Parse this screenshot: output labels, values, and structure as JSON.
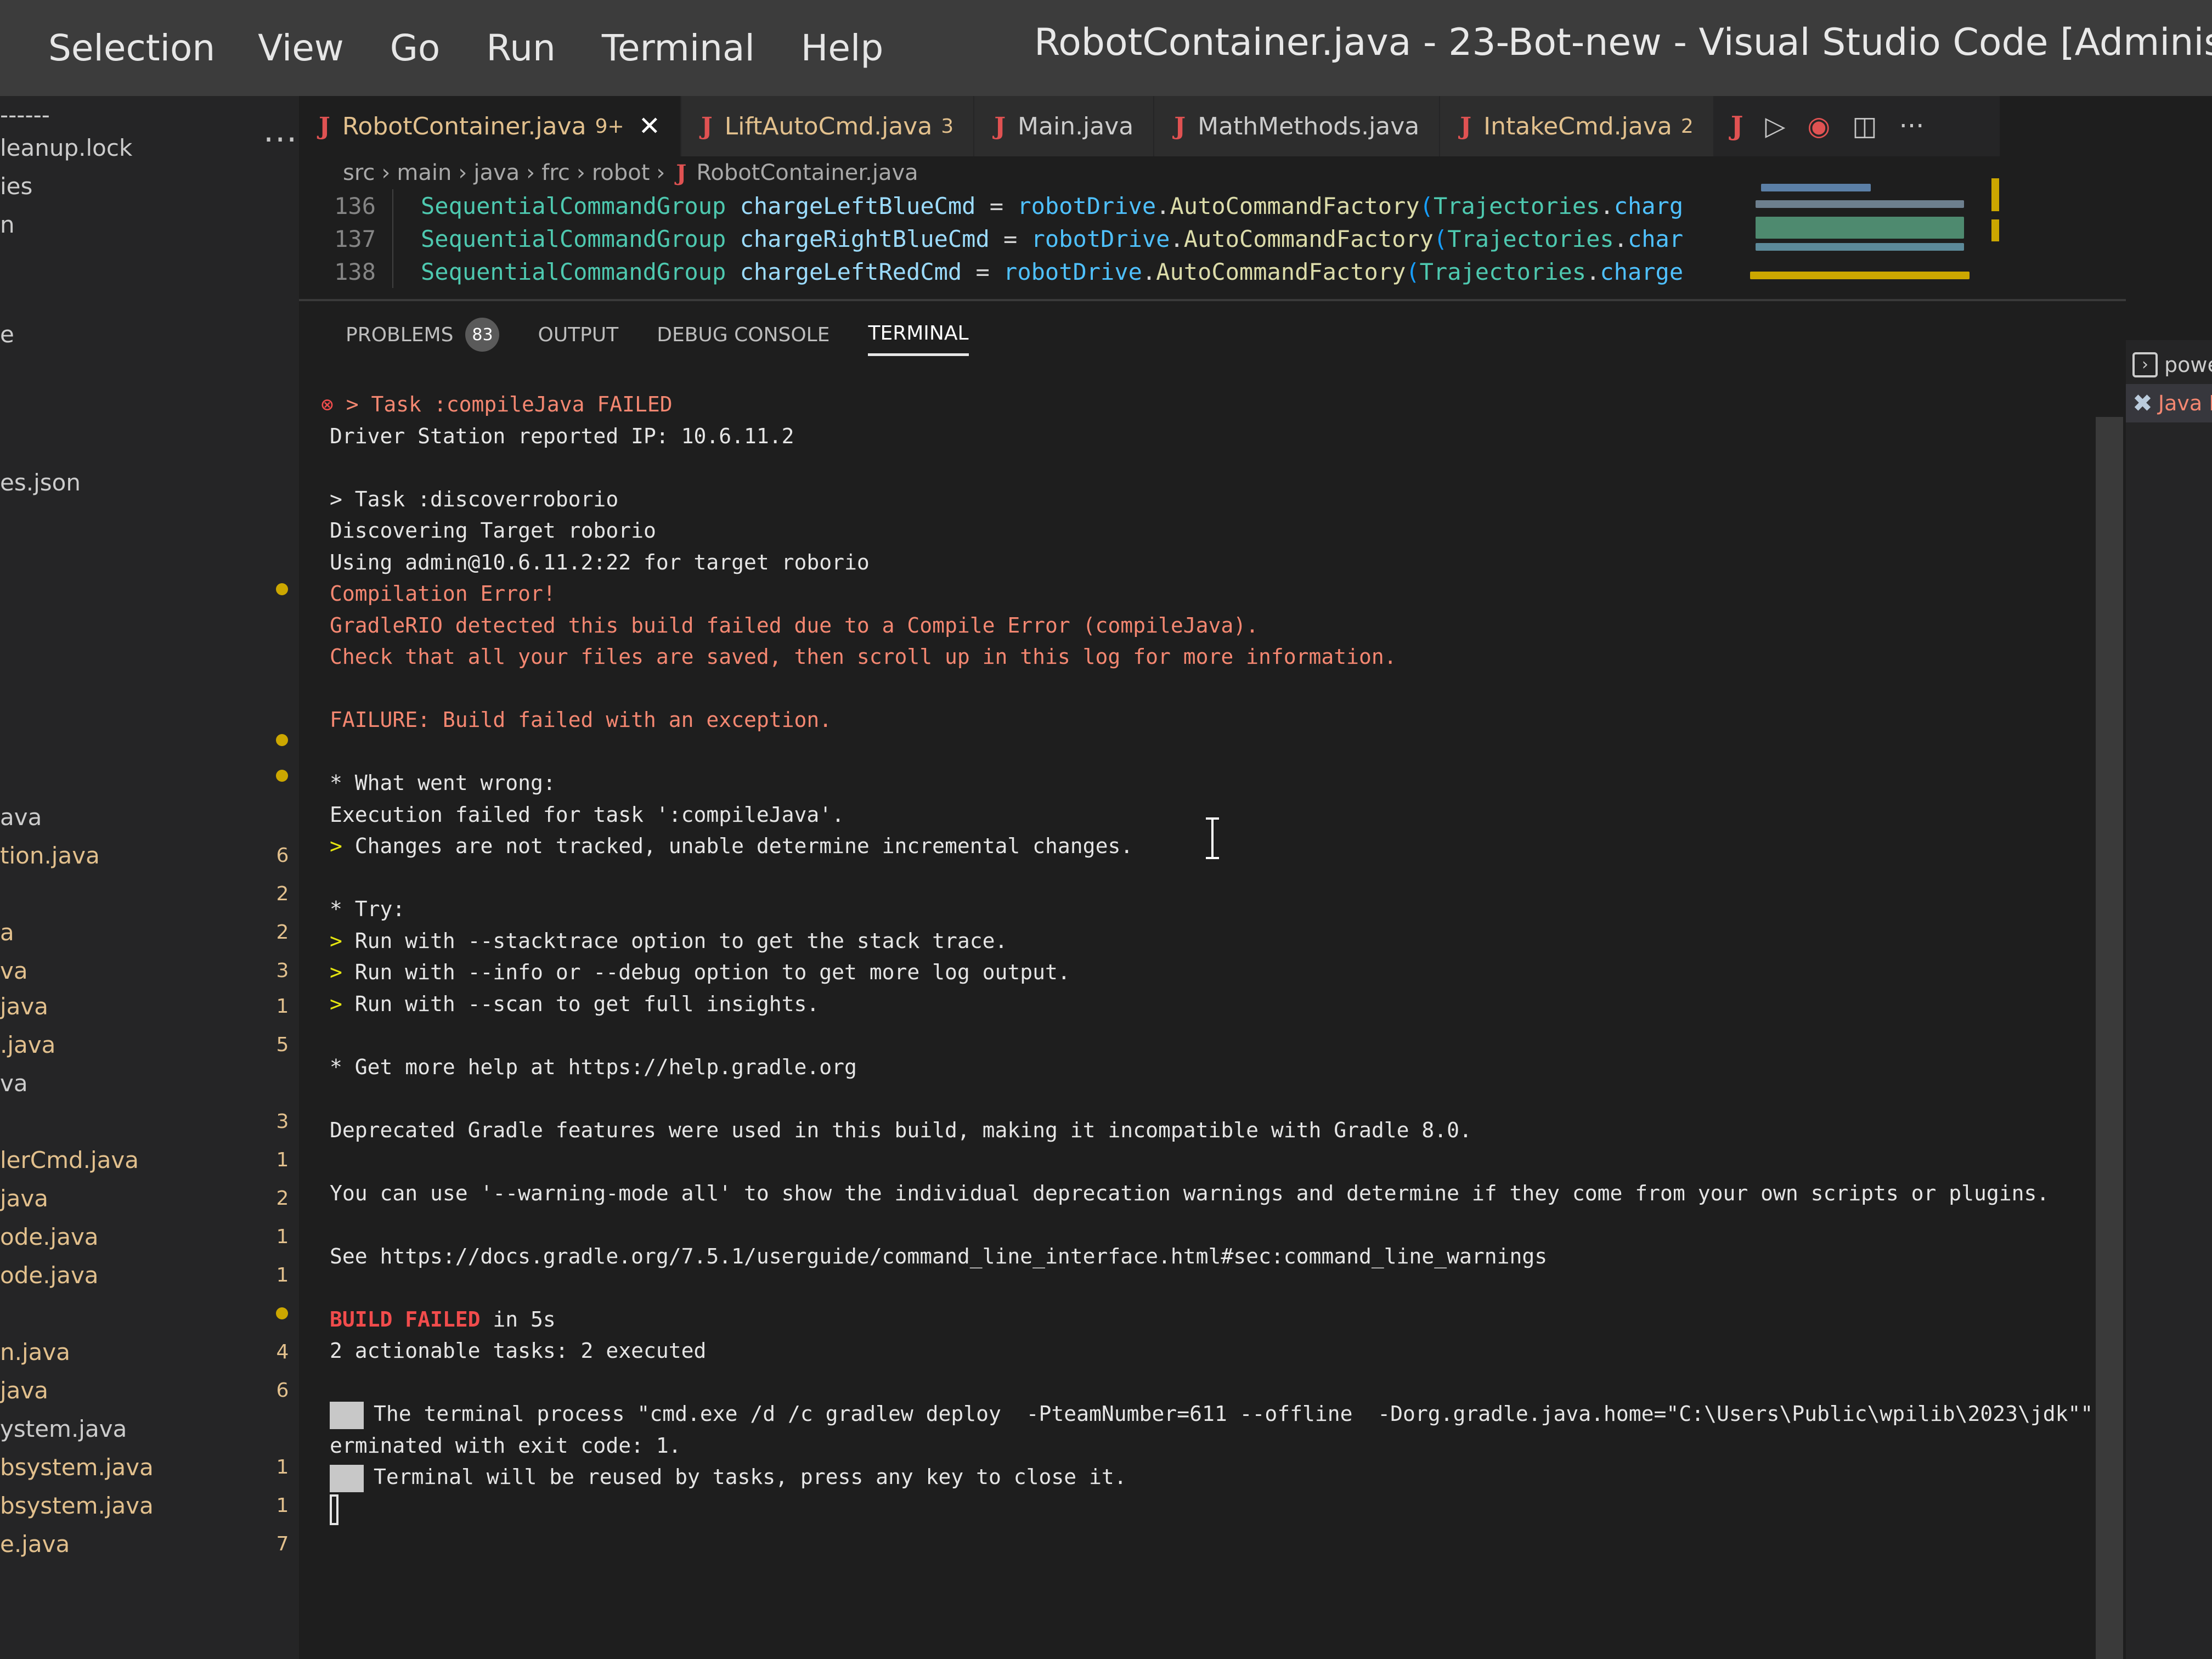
{
  "menu": {
    "items": [
      "Selection",
      "View",
      "Go",
      "Run",
      "Terminal",
      "Help"
    ]
  },
  "window_title": "RobotContainer.java - 23-Bot-new - Visual Studio Code [Administrator]",
  "sidebar": {
    "more_label": "...",
    "items": [
      {
        "label": "------",
        "badge": "",
        "status": "normal",
        "dot": false
      },
      {
        "label": "leanup.lock",
        "badge": "",
        "status": "normal",
        "dot": false
      },
      {
        "label": "ies",
        "badge": "",
        "status": "normal",
        "dot": false
      },
      {
        "label": "n",
        "badge": "",
        "status": "normal",
        "dot": false
      },
      {
        "label": "e",
        "badge": "",
        "status": "normal",
        "dot": false
      },
      {
        "label": "es.json",
        "badge": "",
        "status": "normal",
        "dot": false
      },
      {
        "label": "",
        "badge": "",
        "status": "warn",
        "dot": true
      },
      {
        "label": "",
        "badge": "",
        "status": "warn",
        "dot": true
      },
      {
        "label": "",
        "badge": "",
        "status": "warn",
        "dot": true
      },
      {
        "label": "ava",
        "badge": "",
        "status": "normal",
        "dot": false
      },
      {
        "label": "tion.java",
        "badge": "6",
        "status": "warn",
        "dot": false
      },
      {
        "label": "",
        "badge": "2",
        "status": "warn",
        "dot": false
      },
      {
        "label": "a",
        "badge": "2",
        "status": "warn",
        "dot": false
      },
      {
        "label": "va",
        "badge": "3",
        "status": "warn",
        "dot": false
      },
      {
        "label": "java",
        "badge": "1",
        "status": "warn",
        "dot": false
      },
      {
        "label": ".java",
        "badge": "5",
        "status": "warn",
        "dot": false
      },
      {
        "label": "va",
        "badge": "",
        "status": "normal",
        "dot": false
      },
      {
        "label": "",
        "badge": "3",
        "status": "warn",
        "dot": false
      },
      {
        "label": "lerCmd.java",
        "badge": "1",
        "status": "warn",
        "dot": false
      },
      {
        "label": "java",
        "badge": "2",
        "status": "warn",
        "dot": false
      },
      {
        "label": "ode.java",
        "badge": "1",
        "status": "warn",
        "dot": false
      },
      {
        "label": "ode.java",
        "badge": "1",
        "status": "warn",
        "dot": false
      },
      {
        "label": "",
        "badge": "",
        "status": "warn",
        "dot": true
      },
      {
        "label": "n.java",
        "badge": "4",
        "status": "warn",
        "dot": false
      },
      {
        "label": "java",
        "badge": "6",
        "status": "warn",
        "dot": false
      },
      {
        "label": "ystem.java",
        "badge": "",
        "status": "normal",
        "dot": false
      },
      {
        "label": "bsystem.java",
        "badge": "1",
        "status": "warn",
        "dot": false
      },
      {
        "label": "bsystem.java",
        "badge": "1",
        "status": "warn",
        "dot": false
      },
      {
        "label": "e.java",
        "badge": "7",
        "status": "warn",
        "dot": false
      }
    ]
  },
  "tabs": [
    {
      "label": "RobotContainer.java",
      "count": "9+",
      "active": true,
      "status": "warn",
      "closable": true
    },
    {
      "label": "LiftAutoCmd.java",
      "count": "3",
      "active": false,
      "status": "warn",
      "closable": false
    },
    {
      "label": "Main.java",
      "count": "",
      "active": false,
      "status": "normal",
      "closable": false
    },
    {
      "label": "MathMethods.java",
      "count": "",
      "active": false,
      "status": "normal",
      "closable": false
    },
    {
      "label": "IntakeCmd.java",
      "count": "2",
      "active": false,
      "status": "warn",
      "closable": false
    }
  ],
  "tab_actions": {
    "java_icon": "J",
    "run_icon": "▷",
    "debug_icon": "◉",
    "split_icon": "◫",
    "more_icon": "···"
  },
  "breadcrumb": [
    "src",
    "main",
    "java",
    "frc",
    "robot",
    "RobotContainer.java"
  ],
  "editor": {
    "lines": [
      {
        "number": "136",
        "type": "SequentialCommandGroup",
        "var": "chargeLeftBlueCmd",
        "obj": "robotDrive",
        "fn": "AutoCommandFactory",
        "arg_type": "Trajectories",
        "arg": "chargeLe"
      },
      {
        "number": "137",
        "type": "SequentialCommandGroup",
        "var": "chargeRightBlueCmd",
        "obj": "robotDrive",
        "fn": "AutoCommandFactory",
        "arg_type": "Trajectories",
        "arg": "chargeR"
      },
      {
        "number": "138",
        "type": "SequentialCommandGroup",
        "var": "chargeLeftRedCmd",
        "obj": "robotDrive",
        "fn": "AutoCommandFactory",
        "arg_type": "Trajectories",
        "arg": "chargeLe"
      }
    ]
  },
  "panel": {
    "tabs": [
      {
        "label": "PROBLEMS",
        "badge": "83",
        "active": false
      },
      {
        "label": "OUTPUT",
        "badge": "",
        "active": false
      },
      {
        "label": "DEBUG CONSOLE",
        "badge": "",
        "active": false
      },
      {
        "label": "TERMINAL",
        "badge": "",
        "active": true
      }
    ]
  },
  "terminal": {
    "lines": [
      {
        "text": "> Task :compileJava FAILED",
        "style": "red",
        "prefix": "⊗ "
      },
      {
        "text": "Driver Station reported IP: 10.6.11.2",
        "style": "normal"
      },
      {
        "text": "",
        "style": "normal"
      },
      {
        "text": "> Task :discoverroborio",
        "style": "normal"
      },
      {
        "text": "Discovering Target roborio",
        "style": "normal"
      },
      {
        "text": "Using admin@10.6.11.2:22 for target roborio",
        "style": "normal"
      },
      {
        "text": "Compilation Error!",
        "style": "red"
      },
      {
        "text": "GradleRIO detected this build failed due to a Compile Error (compileJava).",
        "style": "red"
      },
      {
        "text": "Check that all your files are saved, then scroll up in this log for more information.",
        "style": "red"
      },
      {
        "text": "",
        "style": "normal"
      },
      {
        "text": "FAILURE: Build failed with an exception.",
        "style": "red"
      },
      {
        "text": "",
        "style": "normal"
      },
      {
        "text": "* What went wrong:",
        "style": "normal"
      },
      {
        "text": "Execution failed for task ':compileJava'.",
        "style": "normal"
      },
      {
        "text": "Changes are not tracked, unable determine incremental changes.",
        "style": "normal",
        "arrow": "> "
      },
      {
        "text": "",
        "style": "normal"
      },
      {
        "text": "* Try:",
        "style": "normal"
      },
      {
        "text": "Run with --stacktrace option to get the stack trace.",
        "style": "normal",
        "arrow": "> "
      },
      {
        "text": "Run with --info or --debug option to get more log output.",
        "style": "normal",
        "arrow": "> "
      },
      {
        "text": "Run with --scan to get full insights.",
        "style": "normal",
        "arrow": "> "
      },
      {
        "text": "",
        "style": "normal"
      },
      {
        "text": "* Get more help at https://help.gradle.org",
        "style": "normal"
      },
      {
        "text": "",
        "style": "normal"
      },
      {
        "text": "Deprecated Gradle features were used in this build, making it incompatible with Gradle 8.0.",
        "style": "normal"
      },
      {
        "text": "",
        "style": "normal"
      },
      {
        "text": "You can use '--warning-mode all' to show the individual deprecation warnings and determine if they come from your own scripts or plugins.",
        "style": "normal"
      },
      {
        "text": "",
        "style": "normal"
      },
      {
        "text": "See https://docs.gradle.org/7.5.1/userguide/command_line_interface.html#sec:command_line_warnings",
        "style": "normal"
      },
      {
        "text": "",
        "style": "normal"
      },
      {
        "text": " in 5s",
        "style": "normal",
        "badge": "BUILD FAILED"
      },
      {
        "text": "2 actionable tasks: 2 executed",
        "style": "normal"
      },
      {
        "text": "",
        "style": "normal"
      },
      {
        "text": "The terminal process \"cmd.exe /d /c gradlew deploy  -PteamNumber=611 --offline  -Dorg.gradle.java.home=\"C:\\Users\\Public\\wpilib\\2023\\jdk\"\" t",
        "style": "normal",
        "marker": true
      },
      {
        "text": "erminated with exit code: 1.",
        "style": "normal"
      },
      {
        "text": "Terminal will be reused by tasks, press any key to close it.",
        "style": "normal",
        "marker": true
      },
      {
        "text": "",
        "style": "normal",
        "cursor": true
      }
    ]
  },
  "terminal_list": [
    {
      "label": "powershell",
      "icon": "powershell-icon",
      "selected": false,
      "style": "normal"
    },
    {
      "label": "Java D",
      "icon": "tools-icon",
      "selected": true,
      "style": "err"
    }
  ]
}
